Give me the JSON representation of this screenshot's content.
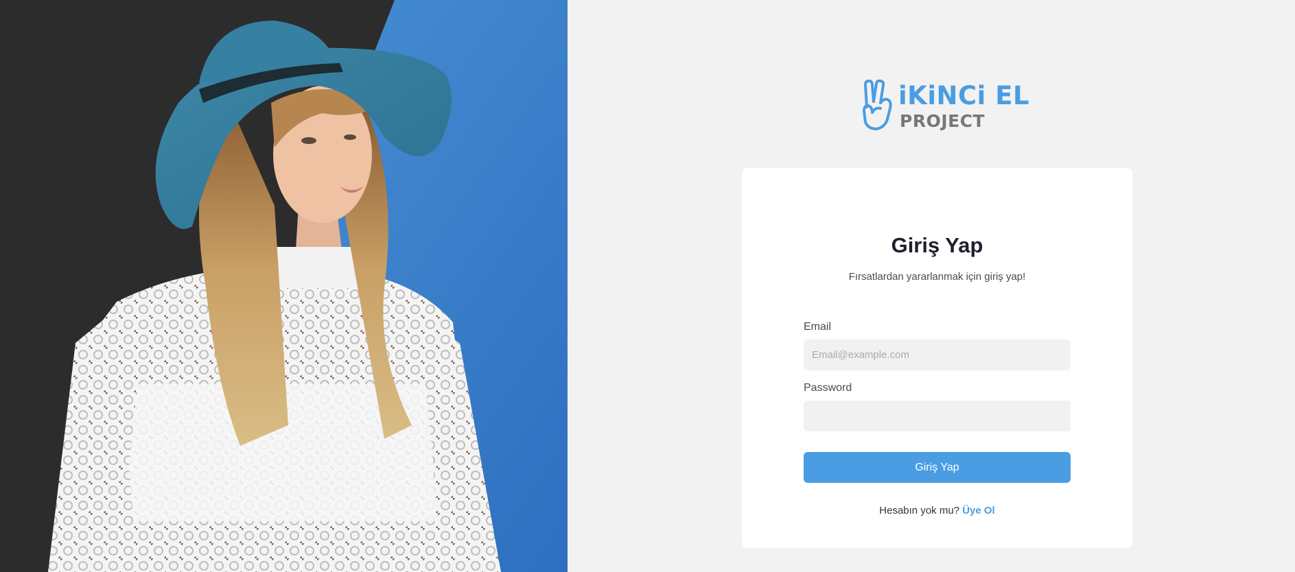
{
  "brand": {
    "logo_line1": "iKiNCi EL",
    "logo_line2": "PROJECT",
    "logo_icon": "peace-hand-icon",
    "accent_color": "#4a9de2",
    "secondary_color": "#777777"
  },
  "hero": {
    "image_alt": "Woman in blue hat and white lace blouse"
  },
  "login_card": {
    "title": "Giriş Yap",
    "subtitle": "Fırsatlardan yararlanmak için giriş yap!",
    "email": {
      "label": "Email",
      "placeholder": "Email@example.com",
      "value": ""
    },
    "password": {
      "label": "Password",
      "placeholder": "",
      "value": ""
    },
    "submit_label": "Giriş Yap",
    "signup_prompt": "Hesabın yok mu?",
    "signup_link": "Üye Ol"
  }
}
